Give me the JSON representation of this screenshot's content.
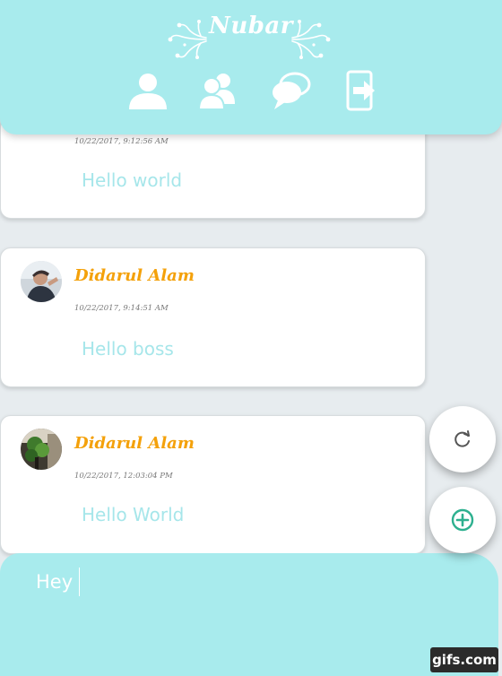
{
  "app": {
    "title": "Nubar",
    "accent": "#a8ebed",
    "name_color": "#f4a10a",
    "message_color": "#a6e6ea"
  },
  "nav": [
    {
      "name": "profile-nav-button",
      "icon": "user-icon"
    },
    {
      "name": "friends-nav-button",
      "icon": "users-icon"
    },
    {
      "name": "chat-nav-button",
      "icon": "chat-bubbles-icon"
    },
    {
      "name": "logout-nav-button",
      "icon": "logout-icon"
    }
  ],
  "messages": [
    {
      "sender": "",
      "time": "10/22/2017, 9:12:56 AM",
      "text": "Hello world"
    },
    {
      "sender": "Didarul Alam",
      "time": "10/22/2017, 9:14:51 AM",
      "text": "Hello boss"
    },
    {
      "sender": "Didarul Alam",
      "time": "10/22/2017, 12:03:04 PM",
      "text": "Hello World"
    }
  ],
  "fabs": {
    "refresh_icon": "refresh-icon",
    "add_icon": "add-circle-icon"
  },
  "composer": {
    "value": "Hey"
  },
  "watermark": "gifs.com"
}
